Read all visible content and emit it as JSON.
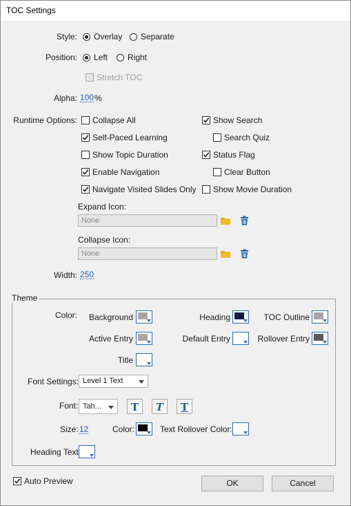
{
  "window": {
    "title": "TOC Settings"
  },
  "style": {
    "label": "Style:",
    "options": [
      "Overlay",
      "Separate"
    ],
    "selected": "Overlay"
  },
  "position": {
    "label": "Position:",
    "options": [
      "Left",
      "Right"
    ],
    "selected": "Left"
  },
  "stretch_toc": {
    "label": "Stretch TOC",
    "checked": false,
    "enabled": false
  },
  "alpha": {
    "label": "Alpha:",
    "value": "100",
    "unit": "%"
  },
  "runtime": {
    "label": "Runtime Options:",
    "left": [
      {
        "label": "Collapse All",
        "checked": false
      },
      {
        "label": "Self-Paced Learning",
        "checked": true
      },
      {
        "label": "Show Topic Duration",
        "checked": false
      },
      {
        "label": "Enable Navigation",
        "checked": true
      },
      {
        "label": "Navigate Visited Slides Only",
        "checked": true
      }
    ],
    "right": [
      {
        "label": "Show Search",
        "checked": true
      },
      {
        "label": "Search Quiz",
        "checked": false
      },
      {
        "label": "Status Flag",
        "checked": true
      },
      {
        "label": "Clear Button",
        "checked": false
      },
      {
        "label": "Show Movie Duration",
        "checked": false
      }
    ]
  },
  "expand_icon": {
    "label": "Expand Icon:",
    "value": "None"
  },
  "collapse_icon": {
    "label": "Collapse Icon:",
    "value": "None"
  },
  "width": {
    "label": "Width:",
    "value": "250"
  },
  "theme": {
    "legend": "Theme",
    "color_label": "Color:",
    "colors": {
      "background": {
        "label": "Background",
        "color": "#a6a6a6"
      },
      "heading": {
        "label": "Heading",
        "color": "#0d1b3d"
      },
      "toc_outline": {
        "label": "TOC Outline",
        "color": "#a6a6a6"
      },
      "active_entry": {
        "label": "Active Entry",
        "color": "#a6a6a6"
      },
      "default_entry": {
        "label": "Default Entry",
        "color": "#ffffff"
      },
      "rollover_entry": {
        "label": "Rollover Entry",
        "color": "#5a5a5a"
      },
      "title": {
        "label": "Title",
        "color": "#ffffff"
      }
    },
    "font_settings": {
      "label": "Font Settings:",
      "value": "Level 1 Text"
    },
    "font": {
      "label": "Font:",
      "value": "Tah...",
      "styles": [
        "T",
        "T",
        "T"
      ]
    },
    "size": {
      "label": "Size:",
      "value": "12"
    },
    "text_color": {
      "label": "Color:",
      "color": "#000000"
    },
    "text_rollover_color": {
      "label": "Text Rollover Color:",
      "color": "#ffffff"
    },
    "heading_text": {
      "label": "Heading Text",
      "color": "#ffffff"
    }
  },
  "auto_preview": {
    "label": "Auto Preview",
    "checked": true
  },
  "buttons": {
    "ok": "OK",
    "cancel": "Cancel"
  },
  "accent": "#2e6bb0",
  "icons": {
    "folder": "folder-icon",
    "trash": "trash-icon"
  }
}
